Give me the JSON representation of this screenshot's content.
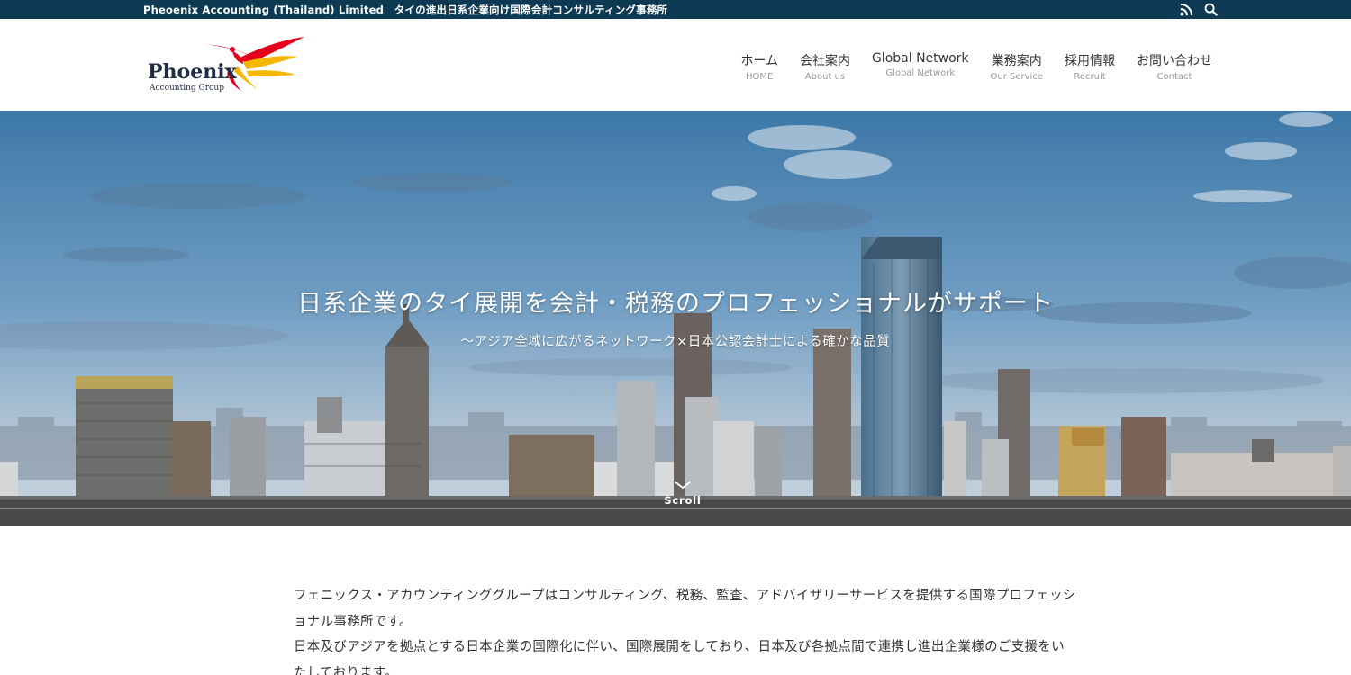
{
  "topbar": {
    "text": "Pheoenix Accounting (Thailand) Limited　タイの進出日系企業向け国際会計コンサルティング事務所",
    "icons": [
      "rss-icon",
      "search-icon"
    ]
  },
  "logo": {
    "name": "Phoenix",
    "tagline": "Accounting Group",
    "colors": [
      "#e3001b",
      "#f5b800"
    ]
  },
  "nav": {
    "items": [
      {
        "label": "ホーム",
        "sub": "HOME"
      },
      {
        "label": "会社案内",
        "sub": "About us"
      },
      {
        "label": "Global Network",
        "sub": "Global Network"
      },
      {
        "label": "業務案内",
        "sub": "Our Service"
      },
      {
        "label": "採用情報",
        "sub": "Recruit"
      },
      {
        "label": "お問い合わせ",
        "sub": "Contact"
      }
    ]
  },
  "hero": {
    "title": "日系企業のタイ展開を会計・税務のプロフェッショナルがサポート",
    "subtitle": "〜アジア全域に広がるネットワーク×日本公認会計士による確かな品質",
    "scroll_label": "Scroll"
  },
  "intro": {
    "paragraph1": "フェニックス・アカウンティンググループはコンサルティング、税務、監査、アドバイザリーサービスを提供する国際プロフェッショナル事務所です。",
    "paragraph2": "日本及びアジアを拠点とする日本企業の国際化に伴い、国際展開をしており、日本及び各拠点間で連携し進出企業様のご支援をいたしております。"
  },
  "colors": {
    "topbar": "#0d3a52",
    "sky_top": "#3d78a8",
    "sky_bottom": "#c6d4df"
  }
}
